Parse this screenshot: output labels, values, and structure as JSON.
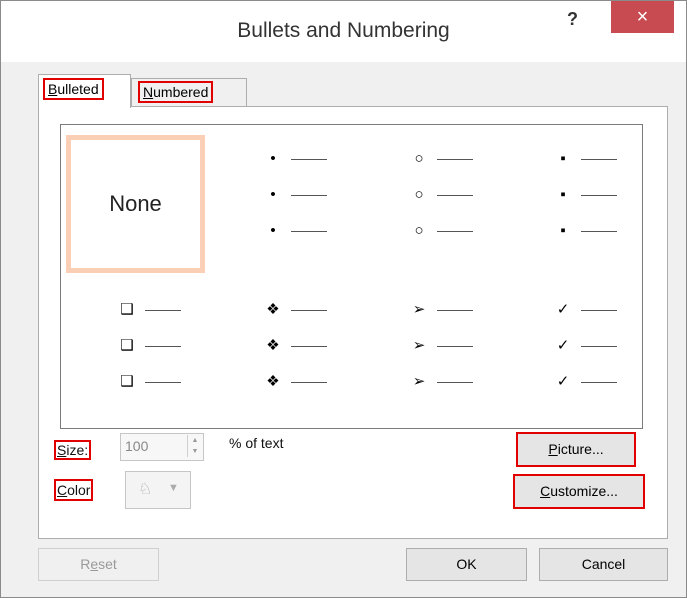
{
  "window": {
    "title": "Bullets and Numbering",
    "help": "?",
    "close": "×"
  },
  "tabs": [
    {
      "label": "Bulleted",
      "underline": "B",
      "rest": "ulleted",
      "active": true
    },
    {
      "label": "Numbered",
      "underline": "N",
      "rest": "umbered",
      "active": false
    }
  ],
  "gallery": {
    "none_label": "None",
    "bullets": [
      "•",
      "○",
      "▪",
      "❑",
      "❖",
      "➢",
      "✓"
    ]
  },
  "size": {
    "label": "Size:",
    "underline": "S",
    "rest": "ize:",
    "value": "100",
    "suffix": "% of text"
  },
  "color": {
    "label": "Color",
    "underline": "C",
    "rest": "olor"
  },
  "buttons": {
    "picture": "Picture...",
    "picture_u": "P",
    "picture_rest": "icture...",
    "customize": "Customize...",
    "customize_u": "C",
    "customize_rest": "ustomize...",
    "reset": "Reset",
    "reset_pre": "R",
    "reset_u": "e",
    "reset_rest": "set",
    "ok": "OK",
    "cancel": "Cancel"
  },
  "colors": {
    "highlight": "#e00000",
    "selection": "#fbcfb6",
    "close": "#c74b50"
  }
}
